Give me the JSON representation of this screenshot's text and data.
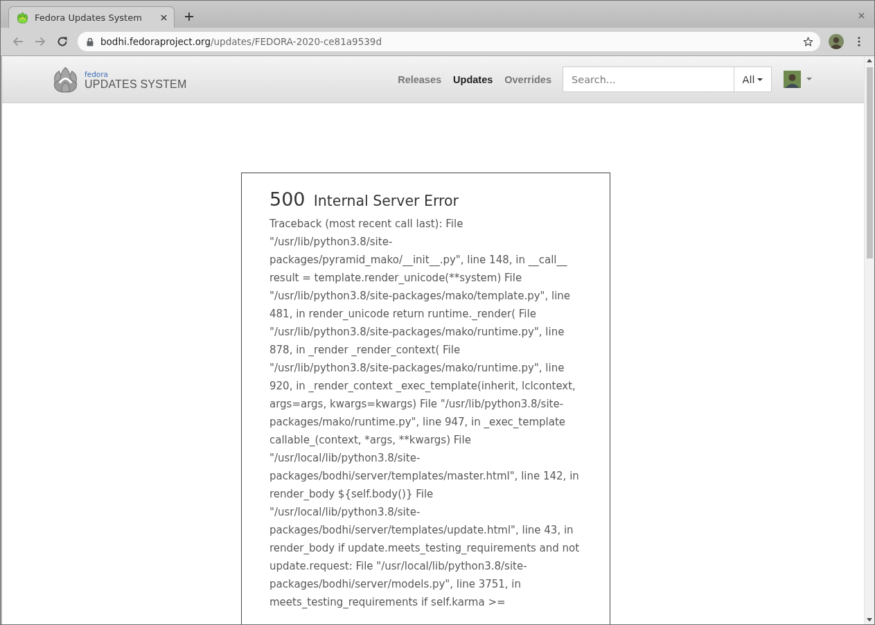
{
  "browser": {
    "tab": {
      "title": "Fedora Updates System",
      "selected": true
    },
    "back": {
      "disabled": true
    },
    "forward": {
      "disabled": true
    },
    "url": {
      "host": "bodhi.fedoraproject.org",
      "path": "/updates/FEDORA-2020-ce81a9539d"
    }
  },
  "navbar": {
    "logo": {
      "subtitle": "fedora",
      "title": "UPDATES SYSTEM"
    },
    "links": [
      {
        "label": "Releases",
        "selected": false
      },
      {
        "label": "Updates",
        "selected": true
      },
      {
        "label": "Overrides",
        "selected": false
      }
    ],
    "search": {
      "placeholder": "Search...",
      "scope": "All"
    }
  },
  "error": {
    "code": "500",
    "title": "Internal Server Error",
    "traceback": "Traceback (most recent call last): File \"/usr/lib/python3.8/site-packages/pyramid_mako/__init__.py\", line 148, in __call__ result = template.render_unicode(**system) File \"/usr/lib/python3.8/site-packages/mako/template.py\", line 481, in render_unicode return runtime._render( File \"/usr/lib/python3.8/site-packages/mako/runtime.py\", line 878, in _render _render_context( File \"/usr/lib/python3.8/site-packages/mako/runtime.py\", line 920, in _render_context _exec_template(inherit, lclcontext, args=args, kwargs=kwargs) File \"/usr/lib/python3.8/site-packages/mako/runtime.py\", line 947, in _exec_template callable_(context, *args, **kwargs) File \"/usr/local/lib/python3.8/site-packages/bodhi/server/templates/master.html\", line 142, in render_body ${self.body()} File \"/usr/local/lib/python3.8/site-packages/bodhi/server/templates/update.html\", line 43, in render_body if update.meets_testing_requirements and not update.request: File \"/usr/local/lib/python3.8/site-packages/bodhi/server/models.py\", line 3751, in meets_testing_requirements if self.karma >="
  }
}
